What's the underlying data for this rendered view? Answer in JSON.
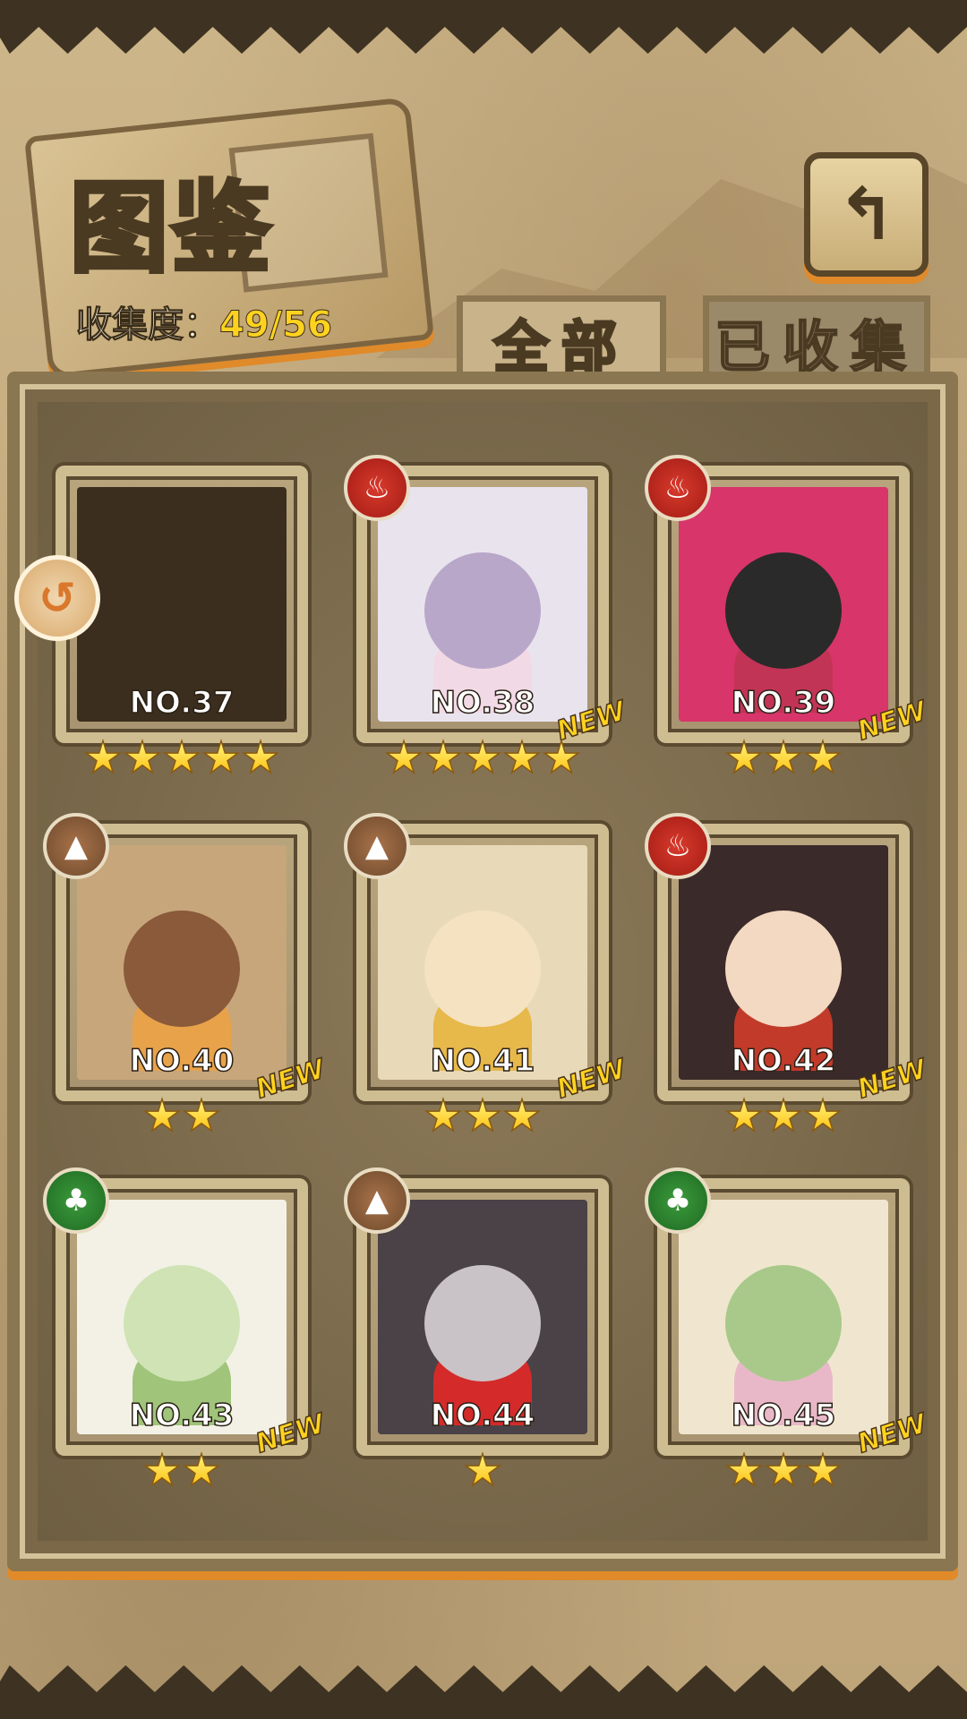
{
  "header": {
    "title": "图鉴",
    "collection_label": "收集度：",
    "collection_value": "49/56",
    "back_icon": "return-arrow-icon"
  },
  "tabs": [
    {
      "label": "全部",
      "active": true
    },
    {
      "label": "已收集",
      "active": false
    }
  ],
  "colors": {
    "accent_orange": "#e08a2a",
    "star": "#ffd21f",
    "fire": "#c22b22",
    "earth": "#8a5a38",
    "wood": "#2a7a2c"
  },
  "cards": [
    {
      "no": "NO.37",
      "stars": 5,
      "element": null,
      "new": false,
      "locked": true,
      "new_label": ""
    },
    {
      "no": "NO.38",
      "stars": 5,
      "element": "fire",
      "new": true,
      "locked": false,
      "new_label": "NEW"
    },
    {
      "no": "NO.39",
      "stars": 3,
      "element": "fire",
      "new": true,
      "locked": false,
      "new_label": "NEW"
    },
    {
      "no": "NO.40",
      "stars": 2,
      "element": "earth",
      "new": true,
      "locked": false,
      "new_label": "NEW"
    },
    {
      "no": "NO.41",
      "stars": 3,
      "element": "earth",
      "new": true,
      "locked": false,
      "new_label": "NEW"
    },
    {
      "no": "NO.42",
      "stars": 3,
      "element": "fire",
      "new": true,
      "locked": false,
      "new_label": "NEW"
    },
    {
      "no": "NO.43",
      "stars": 2,
      "element": "wood",
      "new": true,
      "locked": false,
      "new_label": "NEW"
    },
    {
      "no": "NO.44",
      "stars": 1,
      "element": "earth",
      "new": false,
      "locked": false,
      "new_label": ""
    },
    {
      "no": "NO.45",
      "stars": 3,
      "element": "wood",
      "new": true,
      "locked": false,
      "new_label": "NEW"
    }
  ]
}
